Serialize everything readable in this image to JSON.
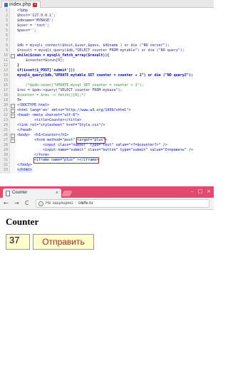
{
  "editor": {
    "tab_label": "index.php",
    "lines": [
      {
        "n": "1",
        "text": "<?php"
      },
      {
        "n": "2",
        "text": "$host='127.0.0.1';"
      },
      {
        "n": "3",
        "text": "$dbname='MYBASE';"
      },
      {
        "n": "4",
        "text": "$user = 'root';"
      },
      {
        "n": "5",
        "text": "$pass='';"
      },
      {
        "n": "6",
        "text": ""
      },
      {
        "n": "7",
        "text": ""
      },
      {
        "n": "8",
        "text": "$db = mysqli_connect($host,$user,$pass, $dbname ) or die (\"NO server\");"
      },
      {
        "n": "9",
        "text": "$result = mysqli_query($db,\"SELECT counter FROM mytable\") or die (\"NO query\");"
      },
      {
        "n": "10",
        "text": "while($coun = mysqli_fetch_array($result)){"
      },
      {
        "n": "11",
        "text": "    $counter=$coun[0];"
      },
      {
        "n": "12",
        "text": "}"
      },
      {
        "n": "13",
        "text": "if(isset($_POST['submit']))"
      },
      {
        "n": "14",
        "text": "mysqli_query($db,\"UPDATE mytable SET counter = counter + 1\") or die (\"NO query2\");"
      },
      {
        "n": "15",
        "text": ""
      },
      {
        "n": "16",
        "text": "    /*$pdo->exec(\"UPDATE mysql SET counter = counter + 1\");"
      },
      {
        "n": "17",
        "text": "$res = $pdo->query(\"SELECT counter FROM mybase\");"
      },
      {
        "n": "18",
        "text": "$counter = $res -> fetch()[0];*/"
      },
      {
        "n": "19",
        "text": "?>"
      },
      {
        "n": "20",
        "text": "<!DOCTYPE html>"
      },
      {
        "n": "21",
        "text": "<html lang='en' xmlns=\"http://www.w3.org/1999/xhtml\">"
      },
      {
        "n": "22",
        "text": "<head> <meta charset=\"utf-8\">"
      },
      {
        "n": "23",
        "text": "        <title>Counter</title>"
      },
      {
        "n": "24",
        "text": "<link rel=\"stylesheet\" href=\"Style.css\"/>"
      },
      {
        "n": "25",
        "text": "</head>"
      },
      {
        "n": "26",
        "text": "<body>  <h1>Counter</h1>"
      },
      {
        "n": "27",
        "text": "        <form method=\"post\" target=\"plus\">"
      },
      {
        "n": "28",
        "text": "            <input class=\"number\" type=\"text\" value=\"<?=$counter?>\" />"
      },
      {
        "n": "29",
        "text": "            <input name=\"submit\" class=\"button\" type=\"submit\" value=\"Отправить\" />"
      },
      {
        "n": "30",
        "text": "        </form>"
      },
      {
        "n": "31",
        "text": "        <iframe name=\"plus\" ></iframe>"
      },
      {
        "n": "32",
        "text": "</body>"
      },
      {
        "n": "33",
        "text": "</html>"
      }
    ]
  },
  "browser": {
    "tab_title": "Counter",
    "tab_close": "×",
    "window_controls": {
      "minimize": "–",
      "maximize": "□",
      "close": "×"
    },
    "nav": {
      "back": "←",
      "forward": "→",
      "reload": "C"
    },
    "address": {
      "security_text": "Не защищено",
      "url": "olefe.ru"
    }
  },
  "page": {
    "heading": "Counter",
    "counter_value": "37",
    "submit_label": "Отправить"
  },
  "icons": [
    "file-icon",
    "close-icon",
    "page-icon",
    "info-icon",
    "back-icon",
    "forward-icon",
    "reload-icon"
  ],
  "colors": {
    "browser_titlebar": "#e34a6d",
    "input_bg": "#ffffcc",
    "button_text": "#d01a1a",
    "highlight_box": "#d02020"
  }
}
